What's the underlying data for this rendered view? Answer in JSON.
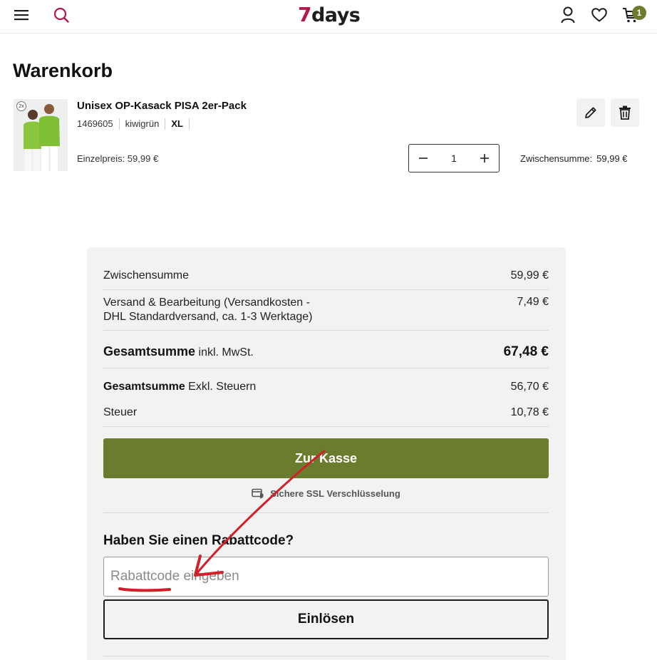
{
  "header": {
    "logo_seven": "7",
    "logo_days": "days",
    "cart_count": "1",
    "icons": [
      "menu-icon",
      "search-icon",
      "account-icon",
      "heart-icon",
      "cart-icon"
    ],
    "brand_color": "#b3194a",
    "accent_color": "#6b7c2f"
  },
  "page": {
    "title": "Warenkorb"
  },
  "cart_item": {
    "name": "Unisex OP-Kasack PISA 2er-Pack",
    "article_no": "1469605",
    "color": "kiwigrün",
    "size": "XL",
    "pack_badge": "2x",
    "unit_price_label": "Einzelpreis: 59,99 €",
    "quantity": "1",
    "subtotal_label": "Zwischensumme:",
    "subtotal_value": "59,99 €"
  },
  "summary": {
    "subtotal_label": "Zwischensumme",
    "subtotal_value": "59,99 €",
    "shipping_label_line1": "Versand & Bearbeitung (Versandkosten -",
    "shipping_label_line2": "DHL Standardversand, ca. 1-3 Werktage)",
    "shipping_value": "7,49 €",
    "total_label": "Gesamtsumme",
    "total_suffix": "inkl. MwSt.",
    "total_value": "67,48 €",
    "net_label": "Gesamtsumme",
    "net_suffix": "Exkl. Steuern",
    "net_value": "56,70 €",
    "tax_label": "Steuer",
    "tax_value": "10,78 €",
    "checkout_label": "Zur Kasse",
    "ssl_label": "Sichere SSL Verschlüsselung"
  },
  "coupon": {
    "heading": "Haben Sie einen Rabattcode?",
    "placeholder": "Rabattcode eingeben",
    "value": "",
    "redeem_label": "Einlösen"
  },
  "annotation_color": "#d0202a"
}
